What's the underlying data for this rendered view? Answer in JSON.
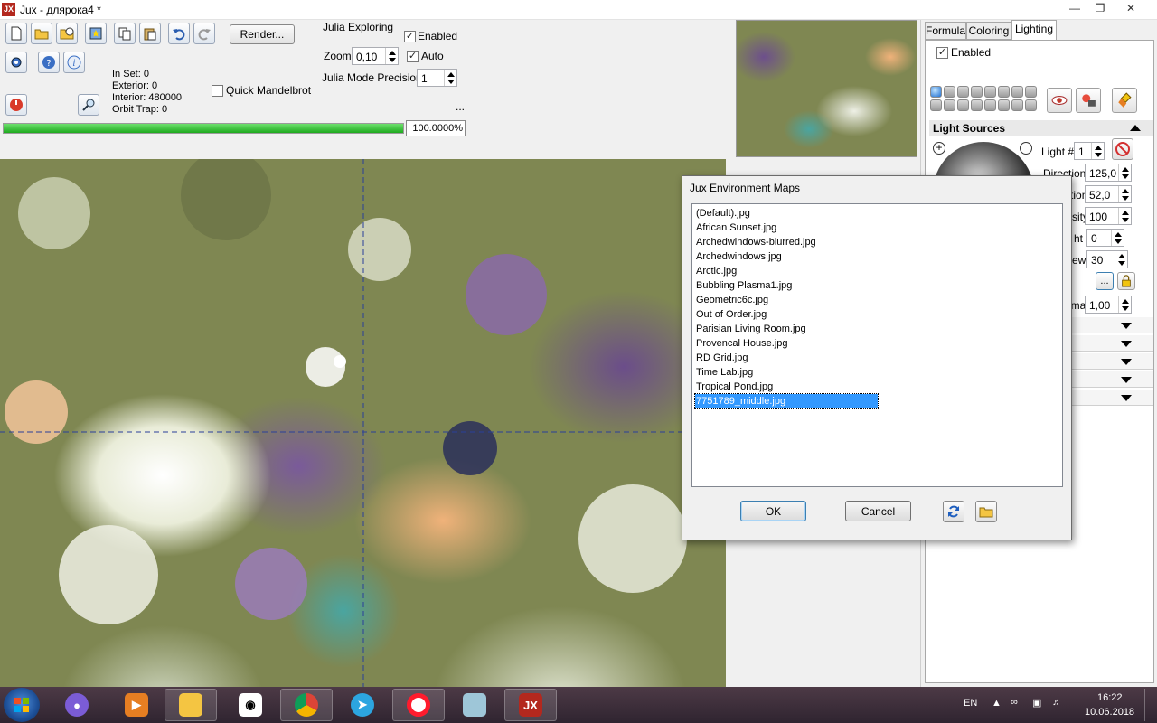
{
  "window": {
    "title": "Jux - длярокa4 *",
    "logo": "JX"
  },
  "toolbar": {
    "render_label": "Render...",
    "stats": {
      "in_set": "In Set: 0",
      "exterior": "Exterior: 0",
      "interior": "Interior: 480000",
      "orbit_trap": "Orbit Trap: 0"
    },
    "quick_mandelbrot": "Quick Mandelbrot",
    "julia": {
      "title": "Julia Exploring",
      "enabled": "Enabled",
      "zoom_label": "Zoom",
      "zoom_value": "0,10",
      "auto": "Auto",
      "precision_label": "Julia Mode Precision",
      "precision_value": "1",
      "more": "..."
    },
    "progress": {
      "fraction": 1.0,
      "text": "100.0000%"
    }
  },
  "right_panel": {
    "tabs": [
      "Formula",
      "Coloring",
      "Lighting"
    ],
    "active_tab": "Lighting",
    "enabled": "Enabled",
    "light_sources_title": "Light Sources",
    "light_num_label": "Light #",
    "light_num_value": "1",
    "direction_label": "Direction",
    "direction_value": "125,0",
    "elevation_label": "Elevation",
    "elevation_value": "52,0",
    "intensity_label": "sity",
    "intensity_value": "100",
    "height_label": "ht",
    "height_value": "0",
    "view_label": "ew",
    "view_value": "30",
    "gamma_label": "nma",
    "gamma_value": "1,00",
    "browse": "..."
  },
  "dialog": {
    "title": "Jux Environment Maps",
    "files": [
      "(Default).jpg",
      "African Sunset.jpg",
      "Archedwindows-blurred.jpg",
      "Archedwindows.jpg",
      "Arctic.jpg",
      "Bubbling Plasma1.jpg",
      "Geometric6c.jpg",
      "Out of Order.jpg",
      "Parisian Living Room.jpg",
      "Provencal House.jpg",
      "RD Grid.jpg",
      "Time Lab.jpg",
      "Tropical Pond.jpg",
      "7751789_middle.jpg"
    ],
    "selected_index": 13,
    "ok_label": "OK",
    "cancel_label": "Cancel"
  },
  "taskbar": {
    "language": "EN",
    "time": "16:22",
    "date": "10.06.2018",
    "jux_label": "JX"
  },
  "colors": {
    "accent": "#3399ff",
    "progress": "#1eaa1e",
    "taskbar": "#3a2d38"
  }
}
